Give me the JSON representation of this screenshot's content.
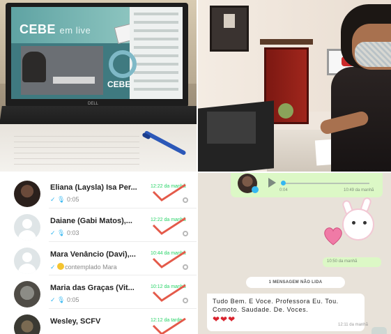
{
  "photo_laptop": {
    "screen_title": "CEBE",
    "screen_title_suffix": "em live",
    "screen_logo": "CEBE",
    "laptop_brand": "DELL"
  },
  "chat_list": {
    "items": [
      {
        "name": "Eliana (Laysla) Isa Per...",
        "time": "12:22 da manhã",
        "preview": "0:05",
        "avatar": "photo"
      },
      {
        "name": "Daiane (Gabi Matos),...",
        "time": "12:22 da manhã",
        "preview": "0:03",
        "avatar": "default"
      },
      {
        "name": "Mara Venâncio (Davi),...",
        "time": "10:44 da manhã",
        "preview": "contemplado Mara",
        "avatar": "default"
      },
      {
        "name": "Maria das Graças (Vit...",
        "time": "10:12 da manhã",
        "preview": "0:05",
        "avatar": "photo"
      },
      {
        "name": "Wesley, SCFV",
        "time": "12:12 da tarde",
        "preview": "",
        "avatar": "photo"
      }
    ],
    "accent_color": "#25d366",
    "check_mark_color": "#e45a4a"
  },
  "conversation": {
    "audio": {
      "duration": "0:04",
      "time": "10:49 da manhã"
    },
    "sticker_time": "10:50 da manhã",
    "unread_banner": "1 MENSAGEM NÃO LIDA",
    "message": {
      "text": "Tudo Bem. E Voce. Professora Eu. Tou. Comoto. Saudade. De. Voces.",
      "hearts": "❤❤❤",
      "time": "12:11 da manhã"
    },
    "outgoing_bubble_color": "#dcf8c6",
    "background_color": "#e8e2d9"
  }
}
